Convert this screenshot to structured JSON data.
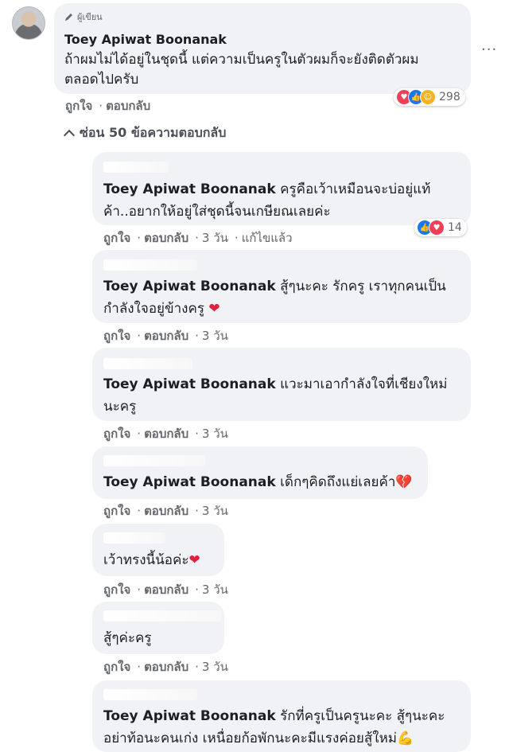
{
  "main_comment": {
    "author_badge": "ผู้เขียน",
    "name": "Toey Apiwat Boonanak",
    "text": "ถ้าผมไม่ได้อยู่ในชุดนี้ แต่ความเป็นครูในตัวผมก็จะยังติดตัวผม\nตลอดไปครับ",
    "like": "ถูกใจ",
    "reply": "ตอบกลับ",
    "reaction_count": "298",
    "more": "···"
  },
  "hide_replies": "ซ่อน 50 ข้อความตอบกลับ",
  "replies": [
    {
      "mention": "Toey Apiwat Boonanak",
      "text": " ครูคือเว้าเหมือนจะบ่อยู่แท้\nค้า..อยากให้อยู่ใส่ชุดนี้จนเกษียณเลยค่ะ",
      "like": "ถูกใจ",
      "reply": "ตอบกลับ",
      "time": "3 วัน",
      "edited": "แก้ไขแล้ว",
      "reaction_count": "14"
    },
    {
      "mention": "Toey Apiwat Boonanak",
      "text": " สู้ๆนะคะ รักครู เราทุกคนเป็น\nกำลังใจอยู่ข้างครู ",
      "emoji": "❤",
      "like": "ถูกใจ",
      "reply": "ตอบกลับ",
      "time": "3 วัน"
    },
    {
      "mention": "Toey Apiwat Boonanak",
      "text": " แวะมาเอากำลังใจที่เชียงใหม่\nนะครู",
      "like": "ถูกใจ",
      "reply": "ตอบกลับ",
      "time": "3 วัน"
    },
    {
      "mention": "Toey Apiwat Boonanak",
      "text": " เด็กๆคิดถึงแย่เลยค้า",
      "emoji": "💔",
      "like": "ถูกใจ",
      "reply": "ตอบกลับ",
      "time": "3 วัน"
    },
    {
      "mention": "",
      "text": "เว้าทรงนี้น้อค่ะ",
      "emoji": "❤",
      "like": "ถูกใจ",
      "reply": "ตอบกลับ",
      "time": "3 วัน"
    },
    {
      "mention": "",
      "text": "สู้ๆค่ะครู",
      "like": "ถูกใจ",
      "reply": "ตอบกลับ",
      "time": "3 วัน"
    },
    {
      "mention": "Toey Apiwat Boonanak",
      "text": " รักที่ครูเป็นครูนะคะ สู้ๆนะคะ\nอย่าท้อนะคนเก่ง เหนื่อยก้อพักนะคะมีแรงค่อยสู้ใหม่",
      "emoji": "💪"
    }
  ],
  "colors": {
    "bubble": "#f0f2f5",
    "muted": "#65676b",
    "love": "#f33e58",
    "like": "#1877f2",
    "care": "#f7b125"
  }
}
